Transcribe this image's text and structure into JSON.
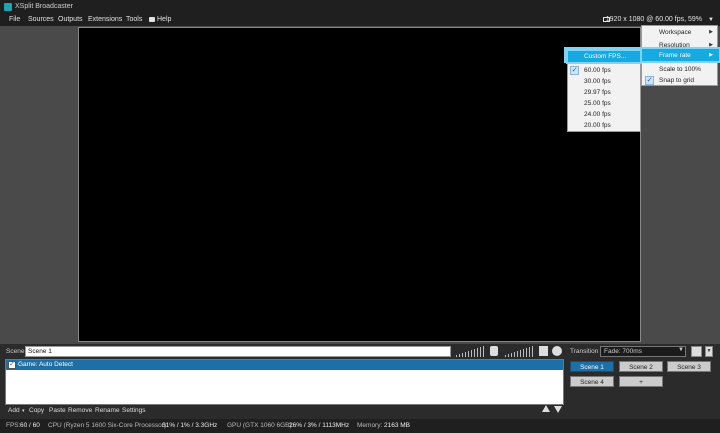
{
  "window": {
    "title": "XSplit Broadcaster"
  },
  "menubar": {
    "items": [
      "File",
      "Sources",
      "Outputs",
      "Extensions",
      "Tools",
      "Help"
    ],
    "resolution_readout": "1920 x 1080 @ 60.00 fps, 59%"
  },
  "main_menu": {
    "items": [
      {
        "label": "Workspace",
        "submenu": true,
        "checked": false
      },
      {
        "label": "Resolution",
        "submenu": true,
        "checked": false
      },
      {
        "label": "Frame rate",
        "submenu": true,
        "checked": false,
        "highlighted": true
      },
      {
        "label": "Scale to 100%",
        "submenu": false,
        "checked": false
      },
      {
        "label": "Snap to grid",
        "submenu": false,
        "checked": true
      }
    ]
  },
  "fps_menu": {
    "items": [
      {
        "label": "Custom FPS...",
        "checked": false,
        "highlighted": true
      },
      {
        "label": "60.00 fps",
        "checked": true
      },
      {
        "label": "30.00 fps",
        "checked": false
      },
      {
        "label": "29.97 fps",
        "checked": false
      },
      {
        "label": "25.00 fps",
        "checked": false
      },
      {
        "label": "24.00 fps",
        "checked": false
      },
      {
        "label": "20.00 fps",
        "checked": false
      }
    ]
  },
  "scene": {
    "label": "Scene",
    "value": "Scene 1"
  },
  "sources": {
    "items": [
      {
        "label": "Game: Auto Detect",
        "checked": true
      }
    ],
    "toolbar": [
      "Add",
      "Copy",
      "Paste",
      "Remove",
      "Rename",
      "Settings"
    ],
    "add_caret": "▾"
  },
  "transition": {
    "label": "Transition",
    "value": "Fade: 700ms"
  },
  "scenes": {
    "buttons": [
      "Scene 1",
      "Scene 2",
      "Scene 3",
      "Scene 4",
      "+"
    ],
    "active": "Scene 1"
  },
  "status": {
    "fps_label": "FPS:",
    "fps_value": "60 / 60",
    "cpu_label": "CPU (Ryzen 5 1600 Six-Core Processor):",
    "cpu_value": "31% / 1% / 3.3GHz",
    "gpu_label": "GPU (GTX 1060 6GB):",
    "gpu_value": "26% / 3% / 1113MHz",
    "mem_label": "Memory:",
    "mem_value": "2163 MB"
  },
  "colors": {
    "accent": "#1d6fa5",
    "highlight": "#17a9e1",
    "preview_bg": "#000000"
  },
  "icons": [
    "app-logo-icon",
    "monitor-icon",
    "mic-icon",
    "speaker-icon",
    "settings-icon",
    "star-icon"
  ]
}
